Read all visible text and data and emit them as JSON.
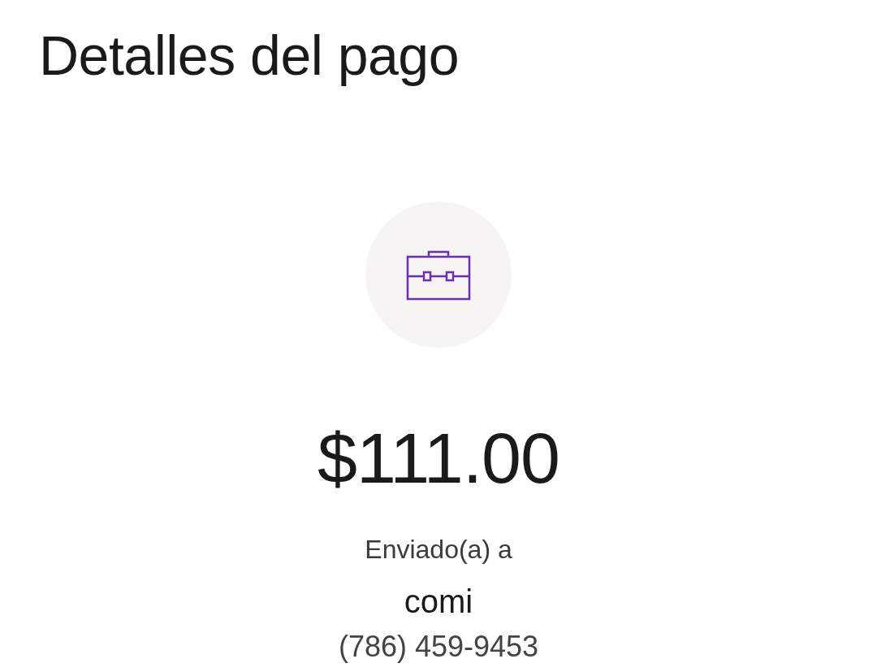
{
  "title": "Detalles del pago",
  "amount": "$111.00",
  "sent_label": "Enviado(a) a",
  "recipient": {
    "name": "comi",
    "phone": "(786) 459-9453"
  }
}
